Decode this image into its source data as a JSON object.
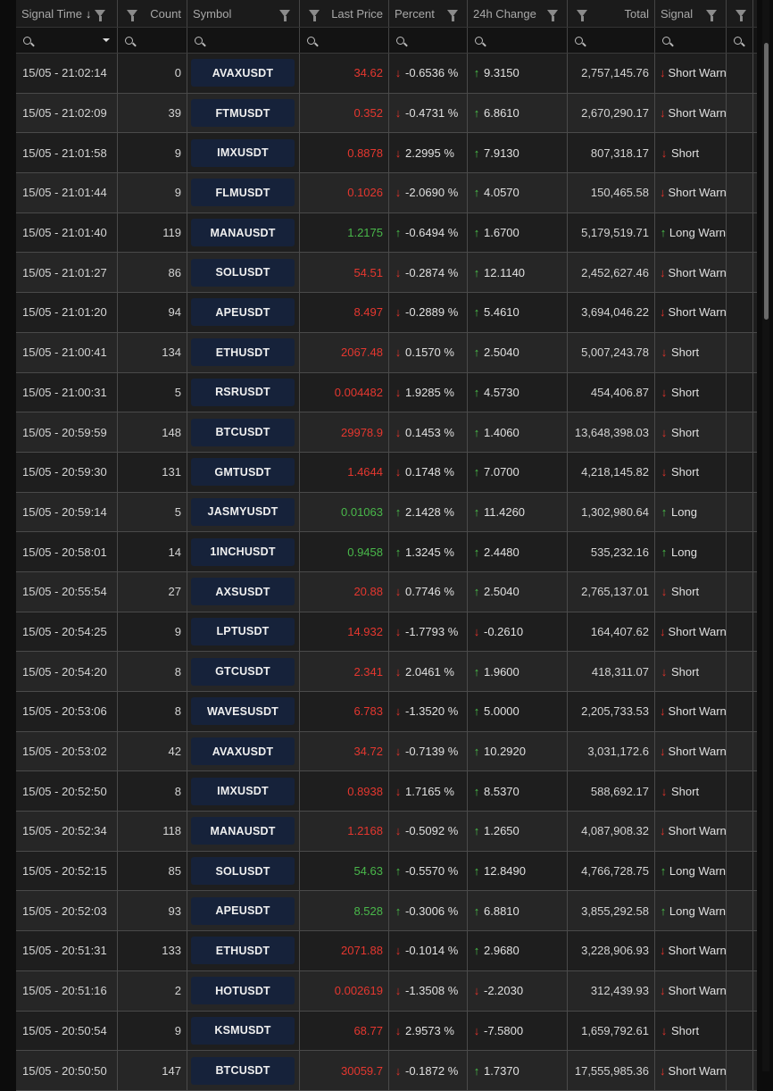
{
  "columns": {
    "signal_time": "Signal Time",
    "count": "Count",
    "symbol": "Symbol",
    "last_price": "Last Price",
    "percent": "Percent",
    "change_24h": "24h Change",
    "total": "Total",
    "signal": "Signal",
    "sort_arrow": "↓"
  },
  "icons": {
    "filter": "funnel-icon",
    "search": "search-icon",
    "sort": "sort-desc-icon"
  },
  "colors": {
    "up": "#49c24a",
    "down": "#e2322a",
    "symbol_badge": "#16223a"
  },
  "rows": [
    {
      "time": "15/05 - 21:02:14",
      "count": "0",
      "symbol": "AVAXUSDT",
      "price": "34.62",
      "price_dir": "down",
      "pct_dir": "down",
      "pct": "-0.6536 %",
      "chg_dir": "up",
      "chg": "9.3150",
      "total": "2,757,145.76",
      "sig_dir": "down",
      "signal": "Short Warn"
    },
    {
      "time": "15/05 - 21:02:09",
      "count": "39",
      "symbol": "FTMUSDT",
      "price": "0.352",
      "price_dir": "down",
      "pct_dir": "down",
      "pct": "-0.4731 %",
      "chg_dir": "up",
      "chg": "6.8610",
      "total": "2,670,290.17",
      "sig_dir": "down",
      "signal": "Short Warn"
    },
    {
      "time": "15/05 - 21:01:58",
      "count": "9",
      "symbol": "IMXUSDT",
      "price": "0.8878",
      "price_dir": "down",
      "pct_dir": "down",
      "pct": "2.2995 %",
      "chg_dir": "up",
      "chg": "7.9130",
      "total": "807,318.17",
      "sig_dir": "down",
      "signal": "Short"
    },
    {
      "time": "15/05 - 21:01:44",
      "count": "9",
      "symbol": "FLMUSDT",
      "price": "0.1026",
      "price_dir": "down",
      "pct_dir": "down",
      "pct": "-2.0690 %",
      "chg_dir": "up",
      "chg": "4.0570",
      "total": "150,465.58",
      "sig_dir": "down",
      "signal": "Short Warn"
    },
    {
      "time": "15/05 - 21:01:40",
      "count": "119",
      "symbol": "MANAUSDT",
      "price": "1.2175",
      "price_dir": "up",
      "pct_dir": "up",
      "pct": "-0.6494 %",
      "chg_dir": "up",
      "chg": "1.6700",
      "total": "5,179,519.71",
      "sig_dir": "up",
      "signal": "Long Warn"
    },
    {
      "time": "15/05 - 21:01:27",
      "count": "86",
      "symbol": "SOLUSDT",
      "price": "54.51",
      "price_dir": "down",
      "pct_dir": "down",
      "pct": "-0.2874 %",
      "chg_dir": "up",
      "chg": "12.1140",
      "total": "2,452,627.46",
      "sig_dir": "down",
      "signal": "Short Warn"
    },
    {
      "time": "15/05 - 21:01:20",
      "count": "94",
      "symbol": "APEUSDT",
      "price": "8.497",
      "price_dir": "down",
      "pct_dir": "down",
      "pct": "-0.2889 %",
      "chg_dir": "up",
      "chg": "5.4610",
      "total": "3,694,046.22",
      "sig_dir": "down",
      "signal": "Short Warn"
    },
    {
      "time": "15/05 - 21:00:41",
      "count": "134",
      "symbol": "ETHUSDT",
      "price": "2067.48",
      "price_dir": "down",
      "pct_dir": "down",
      "pct": "0.1570 %",
      "chg_dir": "up",
      "chg": "2.5040",
      "total": "5,007,243.78",
      "sig_dir": "down",
      "signal": "Short"
    },
    {
      "time": "15/05 - 21:00:31",
      "count": "5",
      "symbol": "RSRUSDT",
      "price": "0.004482",
      "price_dir": "down",
      "pct_dir": "down",
      "pct": "1.9285 %",
      "chg_dir": "up",
      "chg": "4.5730",
      "total": "454,406.87",
      "sig_dir": "down",
      "signal": "Short"
    },
    {
      "time": "15/05 - 20:59:59",
      "count": "148",
      "symbol": "BTCUSDT",
      "price": "29978.9",
      "price_dir": "down",
      "pct_dir": "down",
      "pct": "0.1453 %",
      "chg_dir": "up",
      "chg": "1.4060",
      "total": "13,648,398.03",
      "sig_dir": "down",
      "signal": "Short"
    },
    {
      "time": "15/05 - 20:59:30",
      "count": "131",
      "symbol": "GMTUSDT",
      "price": "1.4644",
      "price_dir": "down",
      "pct_dir": "down",
      "pct": "0.1748 %",
      "chg_dir": "up",
      "chg": "7.0700",
      "total": "4,218,145.82",
      "sig_dir": "down",
      "signal": "Short"
    },
    {
      "time": "15/05 - 20:59:14",
      "count": "5",
      "symbol": "JASMYUSDT",
      "price": "0.01063",
      "price_dir": "up",
      "pct_dir": "up",
      "pct": "2.1428 %",
      "chg_dir": "up",
      "chg": "11.4260",
      "total": "1,302,980.64",
      "sig_dir": "up",
      "signal": "Long"
    },
    {
      "time": "15/05 - 20:58:01",
      "count": "14",
      "symbol": "1INCHUSDT",
      "price": "0.9458",
      "price_dir": "up",
      "pct_dir": "up",
      "pct": "1.3245 %",
      "chg_dir": "up",
      "chg": "2.4480",
      "total": "535,232.16",
      "sig_dir": "up",
      "signal": "Long"
    },
    {
      "time": "15/05 - 20:55:54",
      "count": "27",
      "symbol": "AXSUSDT",
      "price": "20.88",
      "price_dir": "down",
      "pct_dir": "down",
      "pct": "0.7746 %",
      "chg_dir": "up",
      "chg": "2.5040",
      "total": "2,765,137.01",
      "sig_dir": "down",
      "signal": "Short"
    },
    {
      "time": "15/05 - 20:54:25",
      "count": "9",
      "symbol": "LPTUSDT",
      "price": "14.932",
      "price_dir": "down",
      "pct_dir": "down",
      "pct": "-1.7793 %",
      "chg_dir": "down",
      "chg": "-0.2610",
      "total": "164,407.62",
      "sig_dir": "down",
      "signal": "Short Warn"
    },
    {
      "time": "15/05 - 20:54:20",
      "count": "8",
      "symbol": "GTCUSDT",
      "price": "2.341",
      "price_dir": "down",
      "pct_dir": "down",
      "pct": "2.0461 %",
      "chg_dir": "up",
      "chg": "1.9600",
      "total": "418,311.07",
      "sig_dir": "down",
      "signal": "Short"
    },
    {
      "time": "15/05 - 20:53:06",
      "count": "8",
      "symbol": "WAVESUSDT",
      "price": "6.783",
      "price_dir": "down",
      "pct_dir": "down",
      "pct": "-1.3520 %",
      "chg_dir": "up",
      "chg": "5.0000",
      "total": "2,205,733.53",
      "sig_dir": "down",
      "signal": "Short Warn"
    },
    {
      "time": "15/05 - 20:53:02",
      "count": "42",
      "symbol": "AVAXUSDT",
      "price": "34.72",
      "price_dir": "down",
      "pct_dir": "down",
      "pct": "-0.7139 %",
      "chg_dir": "up",
      "chg": "10.2920",
      "total": "3,031,172.6",
      "sig_dir": "down",
      "signal": "Short Warn"
    },
    {
      "time": "15/05 - 20:52:50",
      "count": "8",
      "symbol": "IMXUSDT",
      "price": "0.8938",
      "price_dir": "down",
      "pct_dir": "down",
      "pct": "1.7165 %",
      "chg_dir": "up",
      "chg": "8.5370",
      "total": "588,692.17",
      "sig_dir": "down",
      "signal": "Short"
    },
    {
      "time": "15/05 - 20:52:34",
      "count": "118",
      "symbol": "MANAUSDT",
      "price": "1.2168",
      "price_dir": "down",
      "pct_dir": "down",
      "pct": "-0.5092 %",
      "chg_dir": "up",
      "chg": "1.2650",
      "total": "4,087,908.32",
      "sig_dir": "down",
      "signal": "Short Warn"
    },
    {
      "time": "15/05 - 20:52:15",
      "count": "85",
      "symbol": "SOLUSDT",
      "price": "54.63",
      "price_dir": "up",
      "pct_dir": "up",
      "pct": "-0.5570 %",
      "chg_dir": "up",
      "chg": "12.8490",
      "total": "4,766,728.75",
      "sig_dir": "up",
      "signal": "Long Warn"
    },
    {
      "time": "15/05 - 20:52:03",
      "count": "93",
      "symbol": "APEUSDT",
      "price": "8.528",
      "price_dir": "up",
      "pct_dir": "up",
      "pct": "-0.3006 %",
      "chg_dir": "up",
      "chg": "6.8810",
      "total": "3,855,292.58",
      "sig_dir": "up",
      "signal": "Long Warn"
    },
    {
      "time": "15/05 - 20:51:31",
      "count": "133",
      "symbol": "ETHUSDT",
      "price": "2071.88",
      "price_dir": "down",
      "pct_dir": "down",
      "pct": "-0.1014 %",
      "chg_dir": "up",
      "chg": "2.9680",
      "total": "3,228,906.93",
      "sig_dir": "down",
      "signal": "Short Warn"
    },
    {
      "time": "15/05 - 20:51:16",
      "count": "2",
      "symbol": "HOTUSDT",
      "price": "0.002619",
      "price_dir": "down",
      "pct_dir": "down",
      "pct": "-1.3508 %",
      "chg_dir": "down",
      "chg": "-2.2030",
      "total": "312,439.93",
      "sig_dir": "down",
      "signal": "Short Warn"
    },
    {
      "time": "15/05 - 20:50:54",
      "count": "9",
      "symbol": "KSMUSDT",
      "price": "68.77",
      "price_dir": "down",
      "pct_dir": "down",
      "pct": "2.9573 %",
      "chg_dir": "down",
      "chg": "-7.5800",
      "total": "1,659,792.61",
      "sig_dir": "down",
      "signal": "Short"
    },
    {
      "time": "15/05 - 20:50:50",
      "count": "147",
      "symbol": "BTCUSDT",
      "price": "30059.7",
      "price_dir": "down",
      "pct_dir": "down",
      "pct": "-0.1872 %",
      "chg_dir": "up",
      "chg": "1.7370",
      "total": "17,555,985.36",
      "sig_dir": "down",
      "signal": "Short Warn"
    }
  ]
}
